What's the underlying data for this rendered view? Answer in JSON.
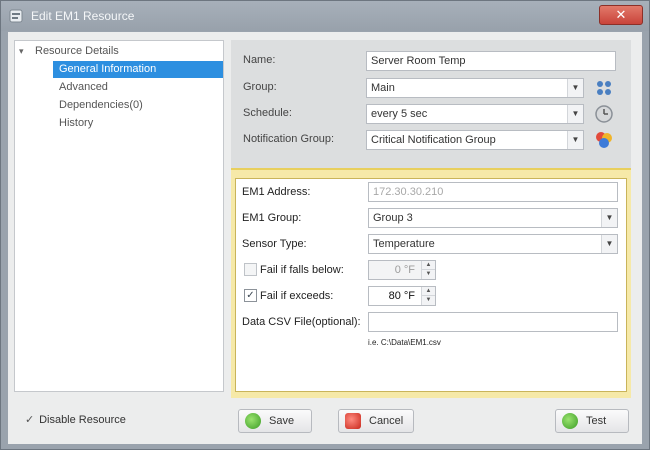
{
  "window": {
    "title": "Edit EM1 Resource",
    "close_symbol": "✕"
  },
  "tree": {
    "root": {
      "label": "Resource Details",
      "expander": "▾"
    },
    "children": [
      {
        "label": "General Information",
        "selected": true
      },
      {
        "label": "Advanced",
        "selected": false
      },
      {
        "label": "Dependencies(0)",
        "selected": false
      },
      {
        "label": "History",
        "selected": false
      }
    ]
  },
  "general": {
    "name_label": "Name:",
    "name_value": "Server Room Temp",
    "group_label": "Group:",
    "group_value": "Main",
    "schedule_label": "Schedule:",
    "schedule_value": "every 5 sec",
    "notification_label": "Notification Group:",
    "notification_value": "Critical Notification Group",
    "icons": [
      "group-manage-icon",
      "schedule-clock-icon",
      "notification-palette-icon"
    ]
  },
  "em1": {
    "address_label": "EM1 Address:",
    "address_value": "172.30.30.210",
    "group_label": "EM1 Group:",
    "group_value": "Group 3",
    "sensor_label": "Sensor Type:",
    "sensor_value": "Temperature",
    "fail_below_label": "Fail if falls below:",
    "fail_below_checked": false,
    "fail_below_value": "0 °F",
    "fail_exceeds_label": "Fail if exceeds:",
    "fail_exceeds_checked": true,
    "fail_exceeds_value": "80 °F",
    "csv_label": "Data CSV File(optional):",
    "csv_value": "",
    "csv_hint": "i.e. C:\\Data\\EM1.csv",
    "check_symbol": "✓"
  },
  "footer": {
    "disable_label": "Disable Resource",
    "disable_symbol": "✓",
    "save_label": "Save",
    "cancel_label": "Cancel",
    "test_label": "Test"
  },
  "colors": {
    "selection": "#2d8fe0",
    "panel_highlight": "#f6e9a8",
    "accent_green": "#3a9b25",
    "accent_red": "#c8271b"
  }
}
